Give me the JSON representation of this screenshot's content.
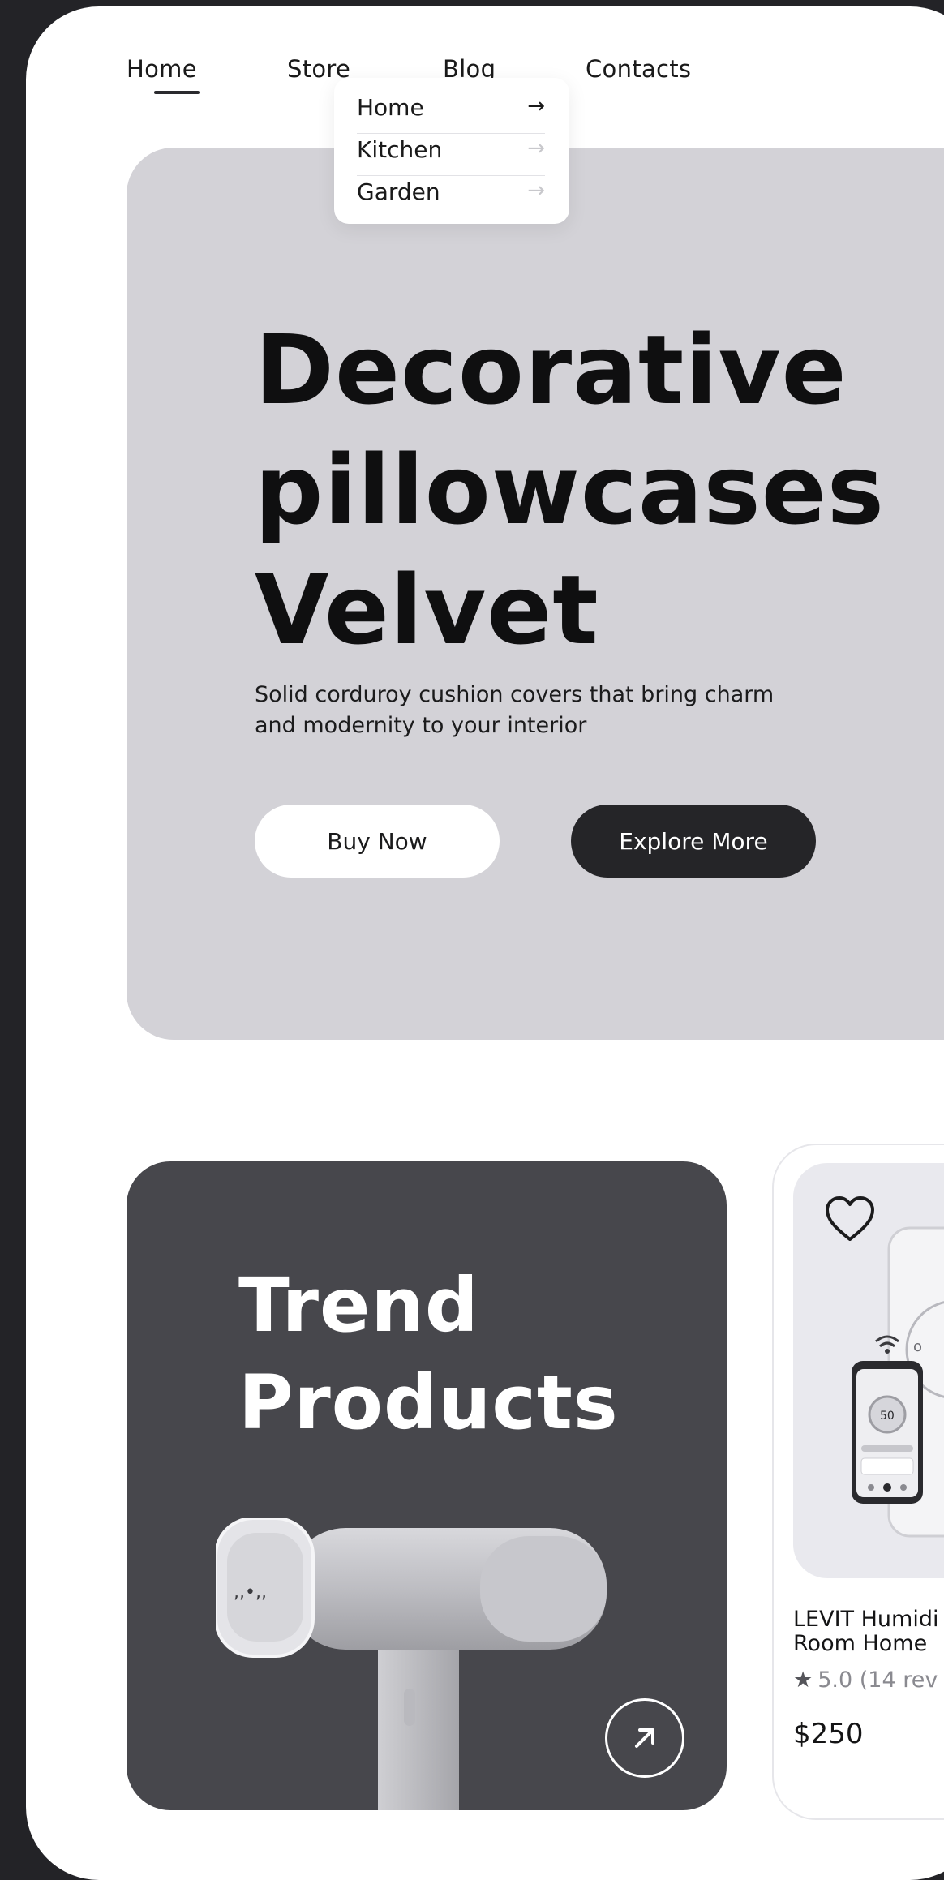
{
  "nav": {
    "items": [
      {
        "label": "Home",
        "active": true
      },
      {
        "label": "Store"
      },
      {
        "label": "Blog"
      },
      {
        "label": "Contacts"
      }
    ],
    "dropdown": {
      "items": [
        {
          "label": "Home",
          "arrow": "→"
        },
        {
          "label": "Kitchen",
          "arrow": "→"
        },
        {
          "label": "Garden",
          "arrow": "→"
        }
      ]
    }
  },
  "hero": {
    "title_lines": [
      "Decorative",
      "pillowcases",
      "Velvet"
    ],
    "subtitle": "Solid corduroy cushion covers  that bring charm and modernity to your interior",
    "buy_label": "Buy Now",
    "explore_label": "Explore More"
  },
  "trend": {
    "title_lines": [
      "Trend",
      "Products"
    ],
    "icon": "arrow-up-right-icon"
  },
  "product": {
    "name_lines": [
      "LEVIT Humidi",
      "Room Home"
    ],
    "rating": "5.0",
    "reviews": "(14 rev",
    "price": "$250",
    "icon": "heart-icon"
  },
  "colors": {
    "frame": "#232327",
    "hero_bg": "#d3d2d7",
    "dark_button": "#252528",
    "trend_bg": "#47474c"
  }
}
